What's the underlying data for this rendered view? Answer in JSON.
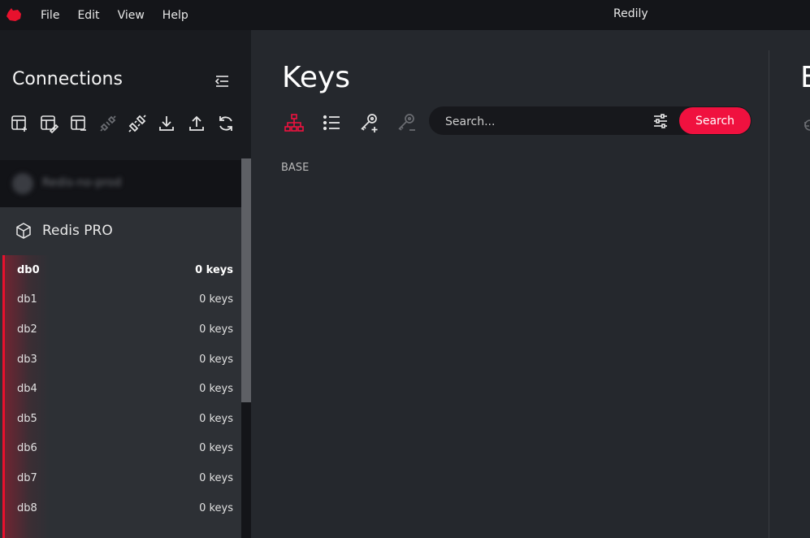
{
  "titlebar": {
    "app_title": "Redily",
    "menu": [
      "File",
      "Edit",
      "View",
      "Help"
    ]
  },
  "sidebar": {
    "title": "Connections",
    "toolbar_icons": [
      "new-connection-icon",
      "edit-connection-icon",
      "remove-connection-icon",
      "disconnect-icon",
      "connect-icon",
      "import-icon",
      "export-icon",
      "refresh-icon"
    ],
    "blurred_connection": "Redis-no-prod",
    "active_connection": {
      "name": "Redis PRO",
      "databases": [
        {
          "name": "db0",
          "keys": "0 keys",
          "active": true
        },
        {
          "name": "db1",
          "keys": "0 keys"
        },
        {
          "name": "db2",
          "keys": "0 keys"
        },
        {
          "name": "db3",
          "keys": "0 keys"
        },
        {
          "name": "db4",
          "keys": "0 keys"
        },
        {
          "name": "db5",
          "keys": "0 keys"
        },
        {
          "name": "db6",
          "keys": "0 keys"
        },
        {
          "name": "db7",
          "keys": "0 keys"
        },
        {
          "name": "db8",
          "keys": "0 keys"
        }
      ]
    }
  },
  "main": {
    "title": "Keys",
    "view_tools": [
      "tree-view-icon",
      "list-view-icon",
      "add-key-icon",
      "remove-key-icon"
    ],
    "search": {
      "placeholder": "Search...",
      "value": "",
      "button_label": "Search"
    },
    "base_label": "BASE"
  },
  "right_panel": {
    "title_partial": "E"
  },
  "colors": {
    "accent": "#f0113f",
    "sidebar_bg": "#191b1f",
    "main_bg": "#25282d",
    "titlebar_bg": "#141519"
  }
}
